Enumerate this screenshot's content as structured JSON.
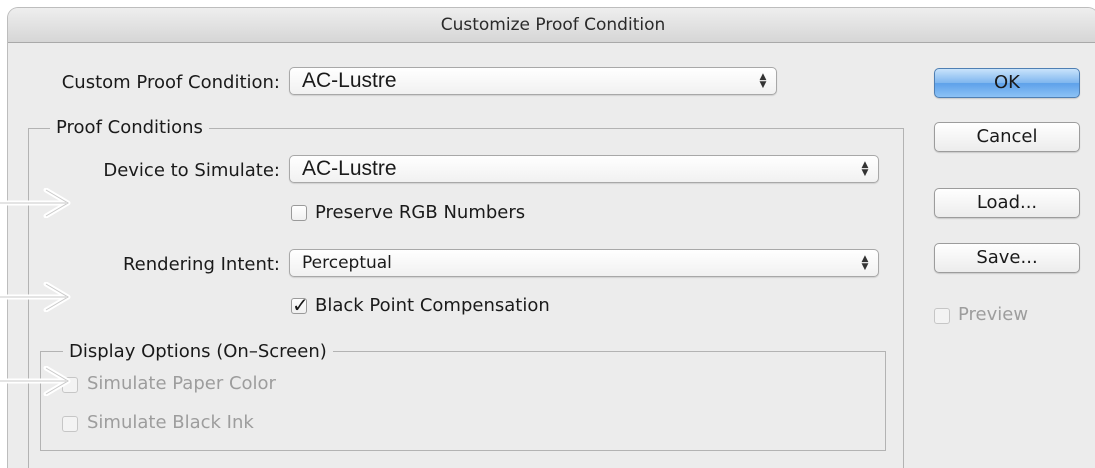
{
  "dialog": {
    "title": "Customize Proof Condition",
    "custom_proof_condition_label": "Custom Proof Condition:",
    "custom_proof_condition_value": "AC-Lustre"
  },
  "proof_conditions": {
    "legend": "Proof Conditions",
    "device_label": "Device to Simulate:",
    "device_value": "AC-Lustre",
    "preserve_rgb_label": "Preserve RGB Numbers",
    "preserve_rgb_checked": false,
    "rendering_intent_label": "Rendering Intent:",
    "rendering_intent_value": "Perceptual",
    "black_point_label": "Black Point Compensation",
    "black_point_checked": true
  },
  "display_options": {
    "legend": "Display Options (On–Screen)",
    "simulate_paper_label": "Simulate Paper Color",
    "simulate_paper_checked": false,
    "simulate_black_label": "Simulate Black Ink",
    "simulate_black_checked": false
  },
  "buttons": {
    "ok": "OK",
    "cancel": "Cancel",
    "load": "Load...",
    "save": "Save..."
  },
  "preview": {
    "label": "Preview",
    "checked": false
  },
  "icons": {
    "popup_stepper": "up-down-chevron-icon",
    "check": "checkmark-icon",
    "annotation_arrow": "right-arrow-icon"
  },
  "colors": {
    "default_button": "#6aa8ec",
    "disabled_text": "#9d9d9d",
    "window_bg": "#ececec"
  }
}
